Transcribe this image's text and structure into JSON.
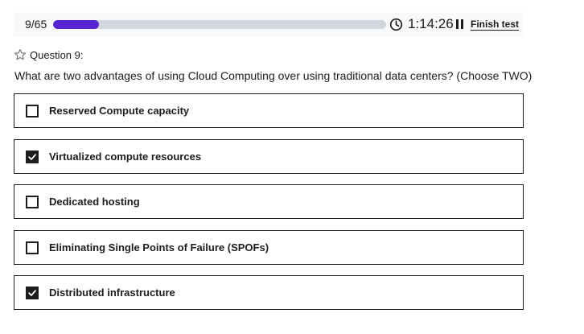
{
  "topbar": {
    "counter": "9/65",
    "progress_fraction": 0.138,
    "timer": "1:14:26",
    "finish_label": "Finish test",
    "icons": {
      "clock": "clock-icon",
      "pause": "pause-icon"
    }
  },
  "question": {
    "number_label": "Question 9:",
    "text": "What are two advantages of using Cloud Computing over using traditional data centers? (Choose TWO)",
    "options": [
      {
        "label": "Reserved Compute capacity",
        "checked": false
      },
      {
        "label": "Virtualized compute resources",
        "checked": true
      },
      {
        "label": "Dedicated hosting",
        "checked": false
      },
      {
        "label": "Eliminating Single Points of Failure (SPOFs)",
        "checked": false
      },
      {
        "label": "Distributed infrastructure",
        "checked": true
      }
    ]
  },
  "colors": {
    "accent": "#5624d0",
    "track": "#d1d7dc",
    "text": "#1c1d1f",
    "topbar_bg": "#f7f9fa"
  }
}
